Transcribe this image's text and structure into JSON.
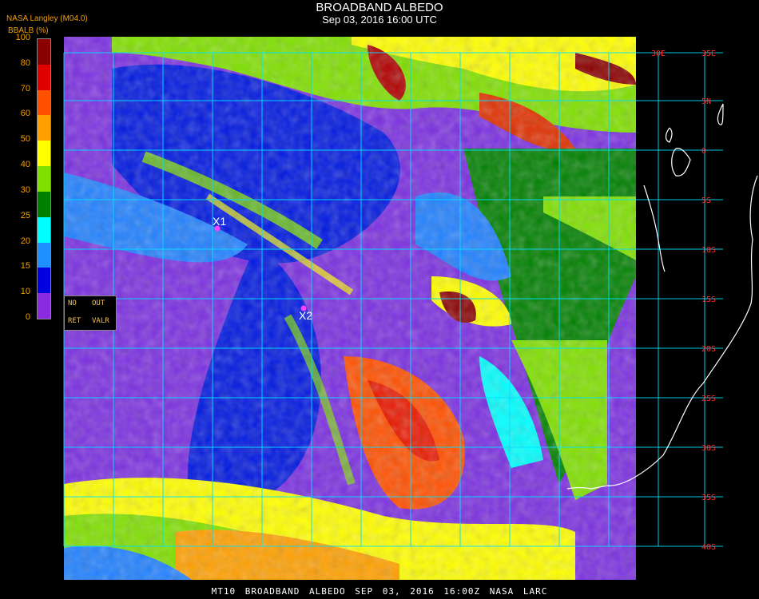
{
  "header": {
    "title": "BROADBAND ALBEDO",
    "subtitle": "Sep 03, 2016 16:00 UTC",
    "producer": "NASA Langley (M04.0)",
    "units": "BBALB (%)"
  },
  "colorbar": {
    "ticks": [
      "100",
      "80",
      "70",
      "60",
      "50",
      "40",
      "30",
      "25",
      "20",
      "15",
      "10",
      "0"
    ],
    "colors": [
      "#8b0000",
      "#e00000",
      "#ff5000",
      "#ffa000",
      "#ffff00",
      "#80e000",
      "#008000",
      "#00ffff",
      "#1e90ff",
      "#0000e0",
      "#8a2be2"
    ]
  },
  "legend_box": {
    "no": "NO",
    "out": "OUT",
    "ret": "RET",
    "valr": "VALR"
  },
  "map": {
    "lat_labels": [
      "35E",
      "5N",
      "0",
      "5S",
      "10S",
      "15S",
      "20S",
      "25S",
      "30S",
      "35S",
      "40S"
    ],
    "lon_top_labels": [
      "30E"
    ],
    "markers": [
      {
        "label": "X1",
        "color": "#ff40ff"
      },
      {
        "label": "X2",
        "color": "#ff40ff"
      }
    ]
  },
  "footer": {
    "text": "MT10  BROADBAND ALBEDO   SEP 03, 2016 16:00Z   NASA LARC"
  }
}
